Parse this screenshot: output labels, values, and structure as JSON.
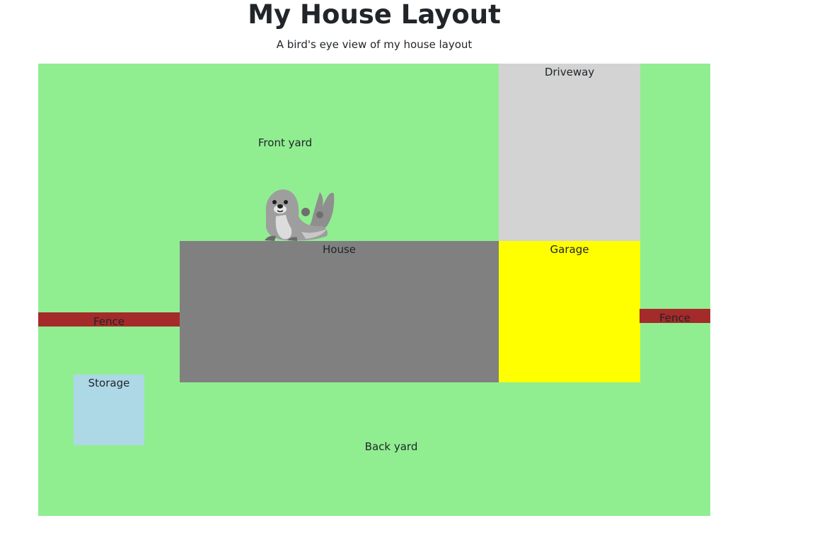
{
  "header": {
    "title": "My House Layout",
    "subtitle": "A bird's eye view of my house layout"
  },
  "layout": {
    "front_yard": {
      "label": "Front yard",
      "color": "#90ee90"
    },
    "back_yard": {
      "label": "Back yard",
      "color": "#90ee90"
    },
    "driveway": {
      "label": "Driveway",
      "color": "#d3d3d3"
    },
    "house": {
      "label": "House",
      "color": "#808080"
    },
    "garage": {
      "label": "Garage",
      "color": "#ffff00"
    },
    "fence_left": {
      "label": "Fence",
      "color": "#a52a2a"
    },
    "fence_right": {
      "label": "Fence",
      "color": "#a52a2a"
    },
    "storage": {
      "label": "Storage",
      "color": "#add8e6"
    }
  },
  "decorations": {
    "mascot_icon": "seal-icon"
  }
}
